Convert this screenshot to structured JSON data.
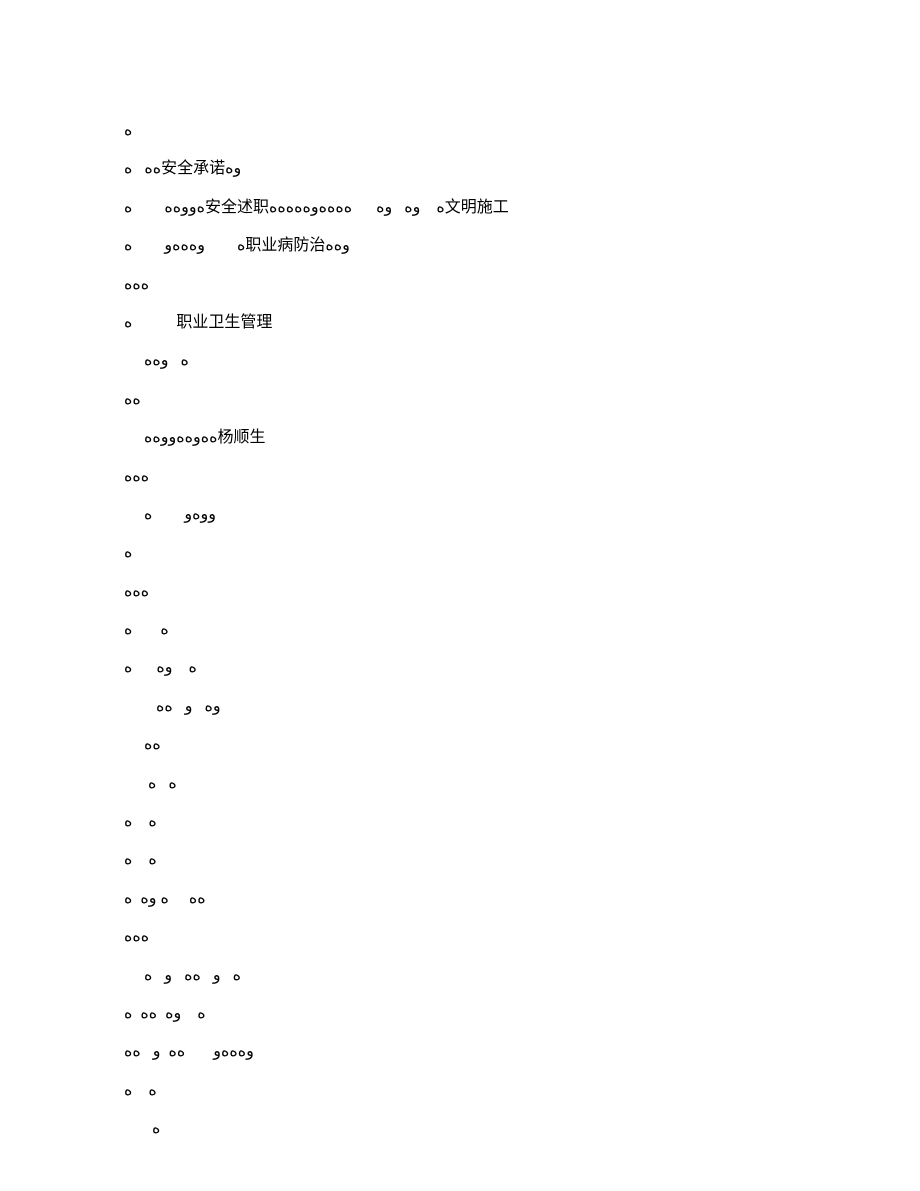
{
  "lines": [
    "ە",
    "ەە   ە安全承诺وە",
    "ەووەە        ە安全述职ە    وە   وە      ەەەەوەەەەە文明施工",
    "ە        وەەەو        ە职业病防治وەە",
    "ەەە",
    "ە           职业卫生管理",
    "     ە   وەە",
    "ەە",
    "     ەەوەەووەە杨顺生",
    "ەەە",
    "     ووەو        ە",
    "ە",
    "ەەە",
    "ە       ە",
    "ە    وە      ە",
    "        وە   و   ەە",
    "     ەە",
    "      ە   ە",
    "ە    ە",
    "ە    ە",
    "ەە     ە وە  ە",
    "ەەە",
    "     ە   و   ەە   و   ە",
    "ە    وە  ەە  ە",
    "وەەەو       ەە  و   ەە",
    "ە    ە",
    "       ە"
  ]
}
